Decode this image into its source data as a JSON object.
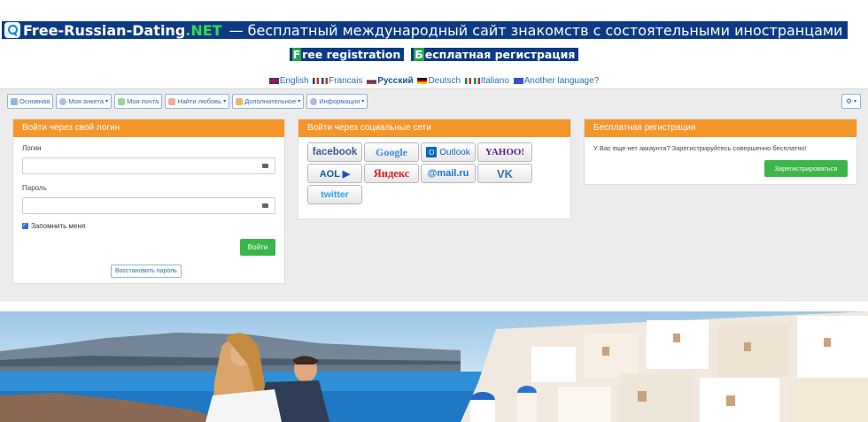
{
  "banner": {
    "brand": "Free-Russian-Dating",
    "tld": ".NET",
    "tagline": "— бесплатный международный сайт знакомств с состоятельными иностранцами"
  },
  "registration_banners": [
    {
      "first": "F",
      "rest": "ree registration"
    },
    {
      "first": "Б",
      "rest": "есплатная регистрация"
    }
  ],
  "languages": [
    {
      "label": "English",
      "flag": "flag-uk"
    },
    {
      "label": "Francais",
      "flag": "flag-fr"
    },
    {
      "label": "Русский",
      "flag": "flag-ru",
      "active": true
    },
    {
      "label": "Deutsch",
      "flag": "flag-de"
    },
    {
      "label": "Italiano",
      "flag": "flag-it"
    },
    {
      "label": "Another language?",
      "flag": "flag-other"
    }
  ],
  "nav": {
    "items": [
      {
        "label": "Основная",
        "icon": "home-icon",
        "dropdown": false
      },
      {
        "label": "Моя анкета",
        "icon": "profile-icon",
        "dropdown": true
      },
      {
        "label": "Моя почта",
        "icon": "mail-icon",
        "dropdown": false
      },
      {
        "label": "Найти любовь",
        "icon": "heart-icon",
        "dropdown": true
      },
      {
        "label": "Дополнительное",
        "icon": "plus-icon",
        "dropdown": true
      },
      {
        "label": "Информация",
        "icon": "question-icon",
        "dropdown": true
      }
    ],
    "settings_icon": "gear-icon",
    "caret": "▾"
  },
  "login": {
    "title": "Войти через свой логин",
    "login_label": "Логин",
    "login_value": "",
    "password_label": "Пароль",
    "password_value": "",
    "remember_label": "Запомнить меня",
    "remember_checked": true,
    "submit_label": "Войти",
    "restore_label": "Восстановить пароль"
  },
  "social": {
    "title": "Войти через социальные сети",
    "providers": [
      {
        "label": "facebook",
        "name": "facebook"
      },
      {
        "label": "Google",
        "name": "google"
      },
      {
        "label": "Outlook",
        "name": "outlook"
      },
      {
        "label": "YAHOO!",
        "name": "yahoo"
      },
      {
        "label": "AOL ▶",
        "name": "aol"
      },
      {
        "label": "Яндекс",
        "name": "yandex"
      },
      {
        "label": "@mail.ru",
        "name": "mailru"
      },
      {
        "label": "VK",
        "name": "vk"
      },
      {
        "label": "twitter",
        "name": "twitter"
      }
    ]
  },
  "signup": {
    "title": "Бесплатная регистрация",
    "text": "У Вас еще нет аккаунта? Зарегистрируйтесь совершенно бесплатно!",
    "button_label": "Зарегистрироваться"
  },
  "colors": {
    "banner_bg": "#0c3b84",
    "card_header": "#f4962a",
    "button_green": "#3cb549"
  }
}
